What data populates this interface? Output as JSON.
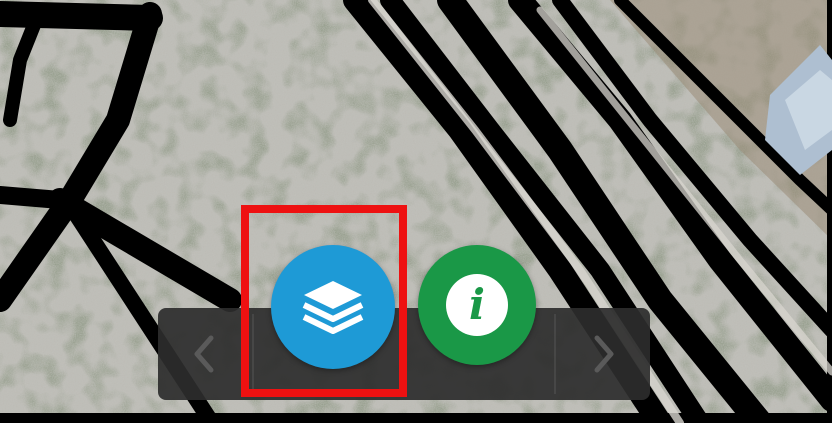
{
  "map": {
    "imagery": "satellite-aerial",
    "road_color": "#000000",
    "terrain_color": "#b9b8b2"
  },
  "toolbar": {
    "background": "#2d2d2d",
    "prev_icon": "chevron-left-icon",
    "next_icon": "chevron-right-icon",
    "layers": {
      "icon": "layers-icon",
      "color": "#1e9ad6"
    },
    "info": {
      "icon": "info-icon",
      "color": "#1a9847",
      "glyph": "i"
    }
  },
  "highlight": {
    "color": "#ee1111",
    "target": "layers-button"
  }
}
